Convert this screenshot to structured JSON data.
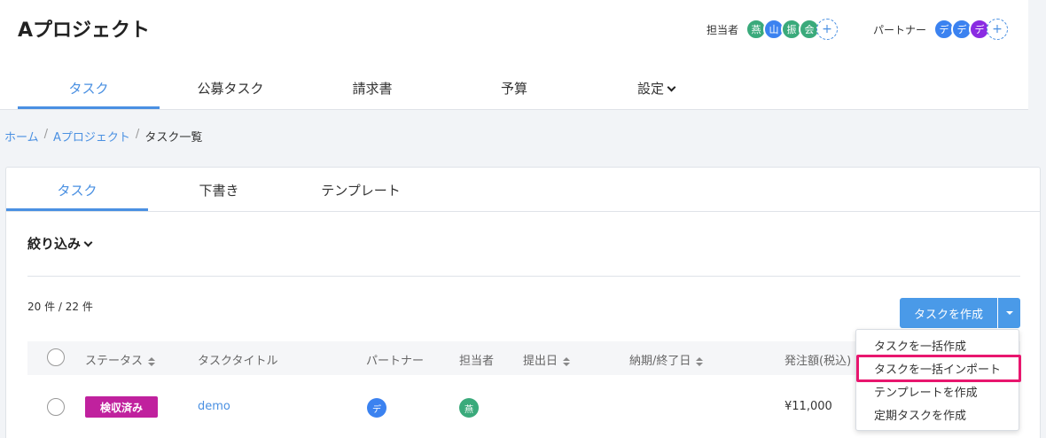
{
  "project": {
    "title": "Aプロジェクト"
  },
  "assignees": {
    "label": "担当者",
    "members": [
      {
        "initial": "燕",
        "color": "#3aaa7b"
      },
      {
        "initial": "山",
        "color": "#3b82f0"
      },
      {
        "initial": "振",
        "color": "#3aaa7b"
      },
      {
        "initial": "会",
        "color": "#3aaa7b"
      }
    ],
    "add": "+"
  },
  "partners": {
    "label": "パートナー",
    "members": [
      {
        "initial": "デ",
        "color": "#3b82f0"
      },
      {
        "initial": "デ",
        "color": "#3b82f0"
      },
      {
        "initial": "デ",
        "color": "#8a2be2"
      }
    ],
    "add": "+"
  },
  "main_nav": [
    "タスク",
    "公募タスク",
    "請求書",
    "予算",
    "設定"
  ],
  "breadcrumb": [
    "ホーム",
    "Aプロジェクト",
    "タスク一覧"
  ],
  "sub_tabs": [
    "タスク",
    "下書き",
    "テンプレート"
  ],
  "filter_label": "絞り込み",
  "count_text": "20 件 / 22 件",
  "create_button": "タスクを作成",
  "columns": [
    "ステータス",
    "タスクタイトル",
    "パートナー",
    "担当者",
    "提出日",
    "納期/終了日",
    "発注額(税込)"
  ],
  "rows": [
    {
      "status": "検収済み",
      "title": "demo",
      "partner": "デ",
      "assignee": "燕",
      "amount": "¥11,000"
    }
  ],
  "dropdown": [
    "タスクを一括作成",
    "タスクを一括インポート",
    "テンプレートを作成",
    "定期タスクを作成"
  ],
  "colors": {
    "accent": "#4a90e2",
    "status_badge": "#c0219e",
    "highlight": "#e8166e"
  }
}
